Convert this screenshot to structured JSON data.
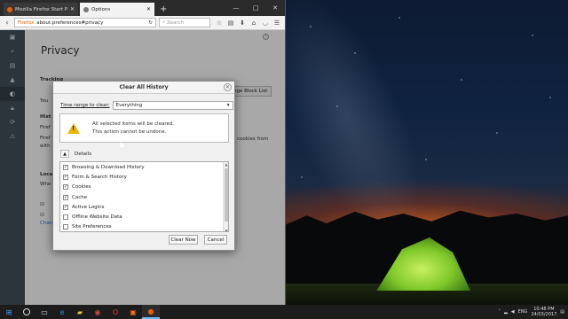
{
  "browser": {
    "tabs": [
      {
        "label": "Mozilla Firefox Start Page",
        "active": false
      },
      {
        "label": "Options",
        "active": true
      }
    ],
    "new_tab": "+",
    "window_controls": [
      "—",
      "□",
      "✕"
    ],
    "url_badge": "Firefox",
    "url": "about:preferences#privacy",
    "search_placeholder": "Search"
  },
  "prefs": {
    "title": "Privacy",
    "sidebar_icons": [
      "general-icon",
      "search-icon",
      "content-icon",
      "applications-icon",
      "privacy-icon",
      "security-icon",
      "sync-icon",
      "advanced-icon"
    ],
    "dimmed": {
      "tracking": "Tracking",
      "you1": "You",
      "hist": "Hist",
      "firef1": "Firef",
      "firef2": "Firef",
      "with": "with",
      "cookies_tail": "cookies from",
      "loca": "Loca",
      "whe": "Whe",
      "you2": "You",
      "chan": "Chan",
      "block_list": "nge Block List"
    }
  },
  "dialog": {
    "title": "Clear All History",
    "time_range_label": "Time range to clear:",
    "time_range_value": "Everything",
    "warning_line1": "All selected items will be cleared.",
    "warning_line2": "This action cannot be undone.",
    "details_label": "Details",
    "items": [
      {
        "label": "Browsing & Download History",
        "checked": true
      },
      {
        "label": "Form & Search History",
        "checked": true
      },
      {
        "label": "Cookies",
        "checked": true
      },
      {
        "label": "Cache",
        "checked": true
      },
      {
        "label": "Active Logins",
        "checked": true
      },
      {
        "label": "Offline Website Data",
        "checked": false
      },
      {
        "label": "Site Preferences",
        "checked": false
      }
    ],
    "clear_now": "Clear Now",
    "cancel": "Cancel"
  },
  "taskbar": {
    "lang": "ENG",
    "time": "10:48 PM",
    "date": "24/03/2017"
  },
  "colors": {
    "firefox_orange": "#e66000",
    "warning_yellow": "#e8b400",
    "sidebar": "#424f5a"
  }
}
